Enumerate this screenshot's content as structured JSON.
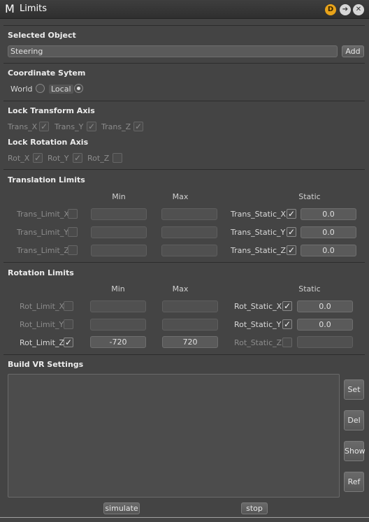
{
  "window": {
    "logo": "M",
    "title": "Limits",
    "icons": [
      "d-badge-icon",
      "arrow-right-icon",
      "close-icon"
    ],
    "d_badge": "D",
    "arrow_glyph": "➔",
    "close_glyph": "✕"
  },
  "selected_object": {
    "title": "Selected Object",
    "value": "Steering",
    "add_label": "Add"
  },
  "coordinate_system": {
    "title": "Coordinate Sytem",
    "world_label": "World",
    "local_label": "Local",
    "selected": "Local"
  },
  "lock_transform": {
    "title": "Lock Transform Axis",
    "items": [
      {
        "label": "Trans_X",
        "checked": true
      },
      {
        "label": "Trans_Y",
        "checked": true
      },
      {
        "label": "Trans_Z",
        "checked": true
      }
    ]
  },
  "lock_rotation": {
    "title": "Lock Rotation Axis",
    "items": [
      {
        "label": "Rot_X",
        "checked": true
      },
      {
        "label": "Rot_Y",
        "checked": true
      },
      {
        "label": "Rot_Z",
        "checked": false
      }
    ]
  },
  "translation_limits": {
    "title": "Translation Limits",
    "col_min": "Min",
    "col_max": "Max",
    "col_static": "Static",
    "rows": [
      {
        "limit_label": "Trans_Limit_X",
        "limit_checked": false,
        "min": "",
        "max": "",
        "static_label": "Trans_Static_X",
        "static_checked": true,
        "static_value": "0.0"
      },
      {
        "limit_label": "Trans_Limit_Y",
        "limit_checked": false,
        "min": "",
        "max": "",
        "static_label": "Trans_Static_Y",
        "static_checked": true,
        "static_value": "0.0"
      },
      {
        "limit_label": "Trans_Limit_Z",
        "limit_checked": false,
        "min": "",
        "max": "",
        "static_label": "Trans_Static_Z",
        "static_checked": true,
        "static_value": "0.0"
      }
    ]
  },
  "rotation_limits": {
    "title": "Rotation Limits",
    "col_min": "Min",
    "col_max": "Max",
    "col_static": "Static",
    "rows": [
      {
        "limit_label": "Rot_Limit_X",
        "limit_checked": false,
        "min": "",
        "max": "",
        "static_label": "Rot_Static_X",
        "static_checked": true,
        "static_value": "0.0"
      },
      {
        "limit_label": "Rot_Limit_Y",
        "limit_checked": false,
        "min": "",
        "max": "",
        "static_label": "Rot_Static_Y",
        "static_checked": true,
        "static_value": "0.0"
      },
      {
        "limit_label": "Rot_Limit_Z",
        "limit_checked": true,
        "min": "-720",
        "max": "720",
        "static_label": "Rot_Static_Z",
        "static_checked": false,
        "static_value": ""
      }
    ]
  },
  "build_vr": {
    "title": "Build VR Settings",
    "side_buttons": [
      "Set",
      "Del",
      "Show",
      "Ref"
    ],
    "simulate_label": "simulate",
    "stop_label": "stop"
  },
  "checkmark": "✓"
}
